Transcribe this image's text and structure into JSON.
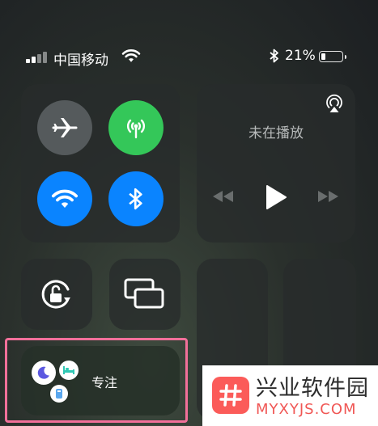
{
  "status_bar": {
    "carrier": "中国移动",
    "battery_percent": "21%",
    "battery_level": 0.21,
    "icons": [
      "signal-icon",
      "wifi-icon",
      "bluetooth-icon",
      "battery-icon"
    ]
  },
  "connectivity": {
    "airplane_mode": {
      "icon": "airplane-icon",
      "active": false,
      "color": "#555a5c"
    },
    "cellular": {
      "icon": "antenna-icon",
      "active": true,
      "color": "#34c759"
    },
    "wifi": {
      "icon": "wifi-icon",
      "active": true,
      "color": "#0a84ff"
    },
    "bluetooth": {
      "icon": "bluetooth-icon",
      "active": true,
      "color": "#0a84ff"
    }
  },
  "now_playing": {
    "status": "未在播放",
    "icons": [
      "airplay-icon",
      "previous-track-icon",
      "play-icon",
      "next-track-icon"
    ]
  },
  "controls": {
    "orientation_lock": {
      "icon": "orientation-lock-icon"
    },
    "screen_mirroring": {
      "icon": "screen-mirroring-icon"
    }
  },
  "focus": {
    "label": "专注",
    "icons": [
      "moon-icon",
      "bed-icon",
      "badge-icon"
    ]
  },
  "highlight_color": "#f2709a",
  "watermark": {
    "name": "兴业软件园",
    "site": "MYXYJS.COM",
    "logo_color": "#fb5b59"
  }
}
